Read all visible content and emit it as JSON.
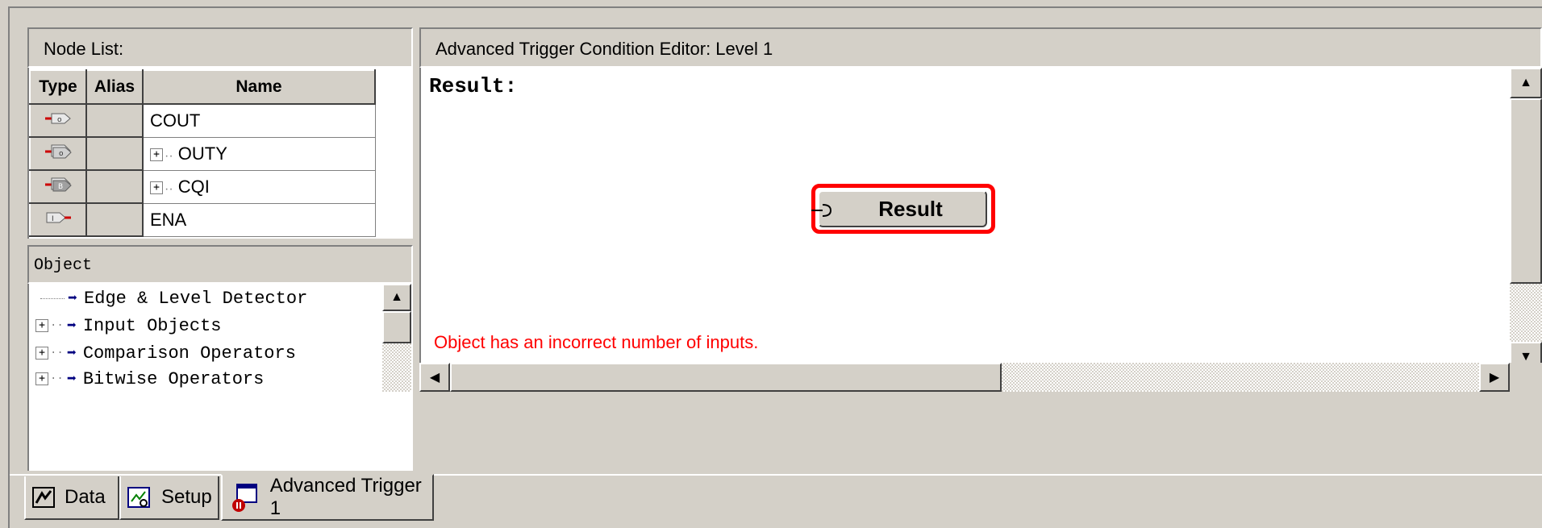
{
  "node_list": {
    "title": "Node List:",
    "columns": {
      "type": "Type",
      "alias": "Alias",
      "name": "Name"
    },
    "rows": [
      {
        "type_icon": "output-pin-icon",
        "alias": "",
        "name": "COUT",
        "expandable": false
      },
      {
        "type_icon": "output-bus-icon",
        "alias": "",
        "name": "OUTY",
        "expandable": true
      },
      {
        "type_icon": "register-bus-icon",
        "alias": "",
        "name": "CQI",
        "expandable": true
      },
      {
        "type_icon": "input-pin-icon",
        "alias": "",
        "name": "ENA",
        "expandable": false
      }
    ]
  },
  "object_panel": {
    "title": "Object",
    "items": [
      {
        "label": "Edge & Level Detector",
        "expandable": false
      },
      {
        "label": "Input Objects",
        "expandable": true
      },
      {
        "label": "Comparison Operators",
        "expandable": true
      },
      {
        "label": "Bitwise Operators",
        "expandable": true
      }
    ]
  },
  "editor": {
    "title": "Advanced Trigger Condition Editor: Level 1",
    "result_heading": "Result:",
    "result_node_label": "Result",
    "error_message": "Object has an incorrect number of inputs.",
    "error_color": "#ff0000",
    "selection_color": "#ff0000"
  },
  "tabs": [
    {
      "label": "Data",
      "icon": "data-icon",
      "active": false
    },
    {
      "label": "Setup",
      "icon": "setup-icon",
      "active": false
    },
    {
      "label": "Advanced Trigger 1",
      "icon": "advanced-trigger-icon",
      "active": true
    }
  ]
}
